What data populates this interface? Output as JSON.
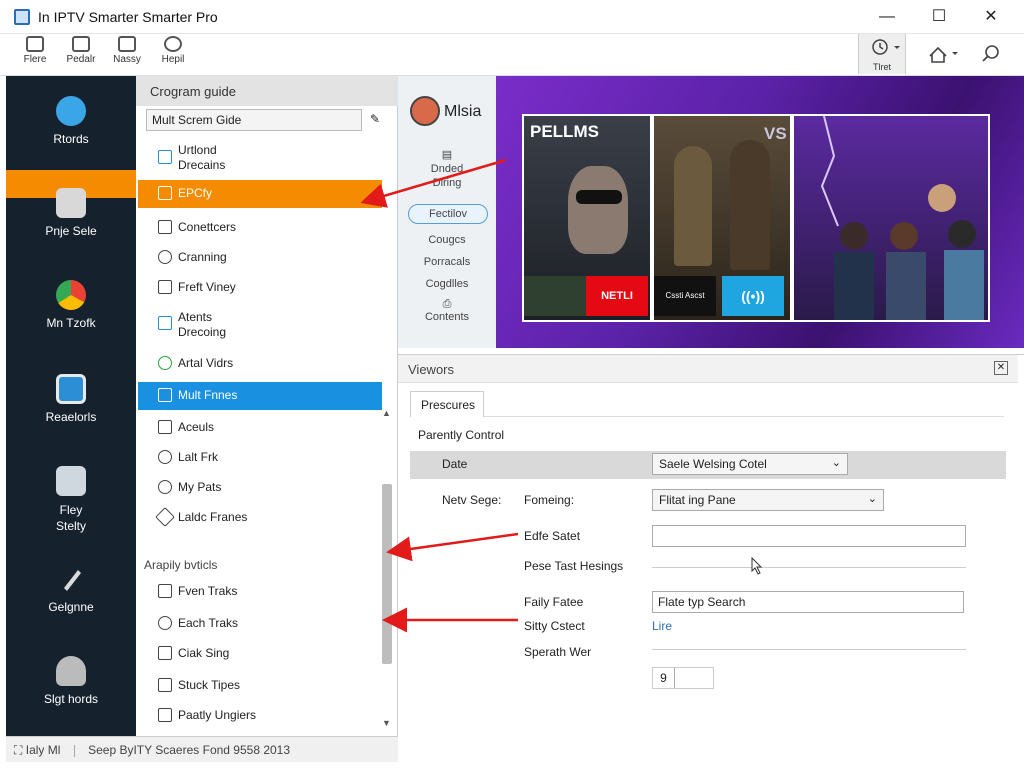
{
  "window": {
    "title": "In IPTV Smarter Smarter Pro",
    "minimize": "—",
    "maximize": "☐",
    "close": "✕"
  },
  "toolbar": {
    "items": [
      {
        "label": "Flere",
        "icon": "film-icon"
      },
      {
        "label": "Pedalr",
        "icon": "tv-icon"
      },
      {
        "label": "Nassy",
        "icon": "document-icon"
      },
      {
        "label": "Hepil",
        "icon": "user-icon"
      }
    ],
    "right": {
      "time_label": "Tlret",
      "home": "home-icon",
      "search": "search-icon"
    }
  },
  "rail": {
    "items": [
      {
        "label": "Rtords",
        "icon": "record-icon",
        "color": "#3aa6e8"
      },
      {
        "label": "Pnje Sele",
        "icon": "folder-icon",
        "color": "#d8d8d8"
      },
      {
        "label": "Mn Tzofk",
        "icon": "chrome-icon",
        "color": "#33a852"
      },
      {
        "label": "Reaelorls",
        "icon": "sheet-icon",
        "color": "#2c8fd6"
      },
      {
        "label": "Fley\nStelty",
        "icon": "file-icon",
        "color": "#cfd8de"
      },
      {
        "label": "Gelgnne",
        "icon": "pen-icon",
        "color": "#dadada"
      },
      {
        "label": "Slgt hords",
        "icon": "person-icon",
        "color": "#bbb"
      }
    ]
  },
  "guide": {
    "header": "Crogram guide",
    "select": "Mult Screm Gide",
    "items": [
      {
        "label": "Urtlond\nDrecains",
        "state": "normal"
      },
      {
        "label": "EPCfy",
        "state": "orange"
      },
      {
        "label": "Conettcers",
        "state": "normal"
      },
      {
        "label": "Cranning",
        "state": "normal"
      },
      {
        "label": "Freft Viney",
        "state": "normal"
      },
      {
        "label": "Atents\nDrecoing",
        "state": "normal"
      },
      {
        "label": "Artal Vidrs",
        "state": "normal"
      },
      {
        "label": "Mult Fnnes",
        "state": "blue"
      },
      {
        "label": "Aceuls",
        "state": "normal"
      },
      {
        "label": "Lalt Frk",
        "state": "normal"
      },
      {
        "label": "My Pats",
        "state": "normal"
      },
      {
        "label": "Laldc Franes",
        "state": "normal"
      }
    ],
    "section_label": "Arapily bvticls",
    "section_items": [
      {
        "label": "Fven Traks"
      },
      {
        "label": "Each Traks"
      },
      {
        "label": "Ciak Sing"
      },
      {
        "label": "Stuck Tipes"
      },
      {
        "label": "Paatly Ungiers"
      }
    ]
  },
  "status": {
    "left": "Ialy Ml",
    "right": "Seep ByITY Scaeres Fond 9558 2013"
  },
  "media": {
    "title": "Mlsia",
    "side_items": [
      "Dnded\nDiring",
      "Fectilov",
      "Cougcs",
      "Porracals",
      "Cogdlles",
      "Contents"
    ],
    "selected_side": "Fectilov",
    "poster1": "PELLMS",
    "poster2": "VS",
    "logos": [
      "",
      "NETLI",
      "Cssti Ascst",
      "((•))"
    ]
  },
  "viewers": {
    "header": "Viewors",
    "tab": "Prescures",
    "parental": "Parently Control",
    "date_label": "Date",
    "date_dropdown": "Saele Welsing Cotel",
    "new_sege": "Netv Sege:",
    "fomeing": "Fomeing:",
    "fomeing_dropdown": "Flitat ing Pane",
    "edfe_label": "Edfe Satet",
    "edfe_value": "",
    "pese_label": "Pese Tast Hesings",
    "faily_label": "Faily Fatee",
    "faily_value": "Flate typ Search",
    "sitty_label": "Sitty Cstect",
    "sitty_value": "Lire",
    "speath_label": "Sperath Wer",
    "spin_value": "9"
  },
  "colors": {
    "accent_orange": "#f58b00",
    "accent_blue": "#1a90e0",
    "rail_bg": "#15222e",
    "arrow_red": "#e21a1a"
  }
}
